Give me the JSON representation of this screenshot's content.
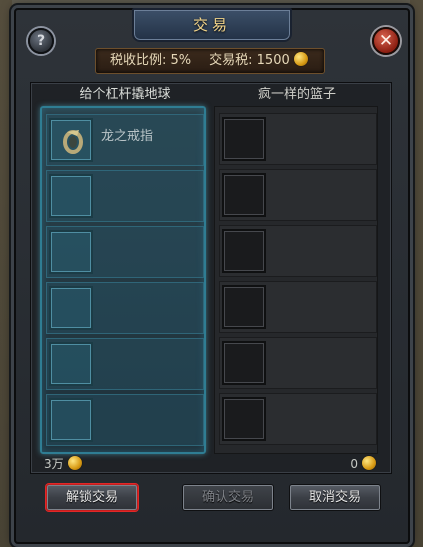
{
  "window": {
    "title": "交易",
    "help_label": "?",
    "close_label": "✕"
  },
  "tax": {
    "rate_label": "税收比例: 5%",
    "tax_label": "交易税: 1500"
  },
  "left": {
    "header": "给个杠杆撬地球",
    "items": [
      {
        "name": "龙之戒指",
        "icon": "ring-icon"
      },
      {
        "name": ""
      },
      {
        "name": ""
      },
      {
        "name": ""
      },
      {
        "name": ""
      },
      {
        "name": ""
      }
    ],
    "gold": "3万"
  },
  "right": {
    "header": "疯一样的篮子",
    "items": [
      {
        "name": ""
      },
      {
        "name": ""
      },
      {
        "name": ""
      },
      {
        "name": ""
      },
      {
        "name": ""
      },
      {
        "name": ""
      }
    ],
    "gold": "0"
  },
  "buttons": {
    "unlock": "解锁交易",
    "confirm": "确认交易",
    "cancel": "取消交易"
  }
}
